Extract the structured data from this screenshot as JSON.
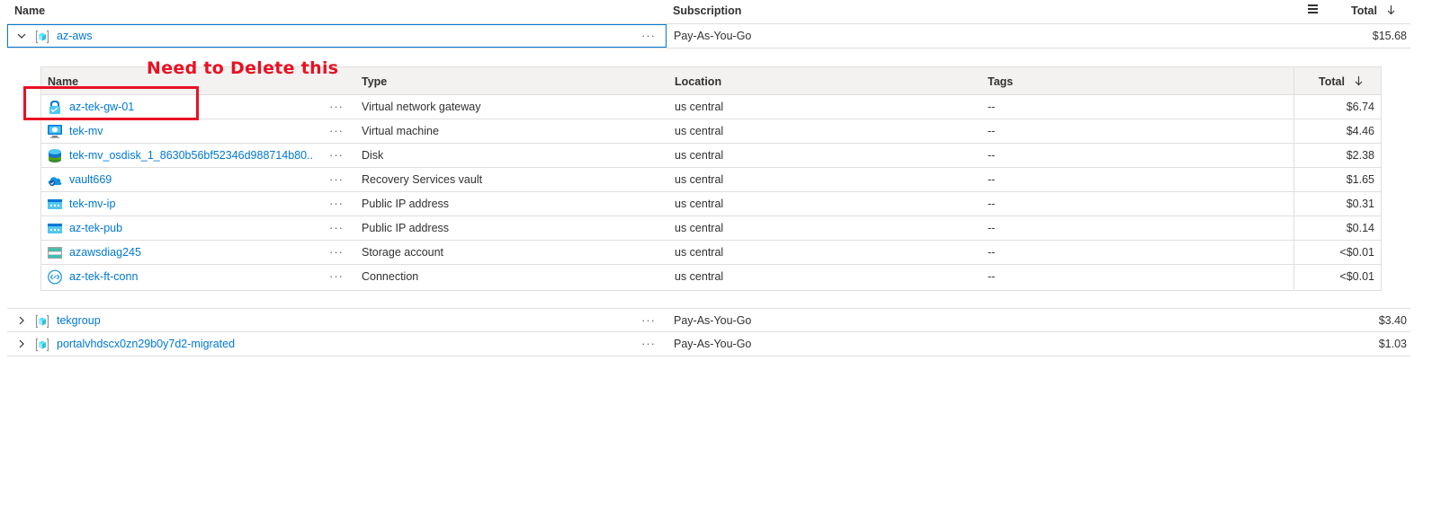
{
  "header": {
    "name_label": "Name",
    "subscription_label": "Subscription",
    "total_label": "Total",
    "sort_icon": "arrow-down-icon",
    "columns_icon": "hamburger-icon"
  },
  "resource_groups": [
    {
      "name": "az-aws",
      "subscription": "Pay-As-You-Go",
      "total": "$15.68",
      "expanded": true,
      "ellipsis": "···"
    },
    {
      "name": "tekgroup",
      "subscription": "Pay-As-You-Go",
      "total": "$3.40",
      "expanded": false,
      "ellipsis": "···"
    },
    {
      "name": "portalvhdscx0zn29b0y7d2-migrated",
      "subscription": "Pay-As-You-Go",
      "total": "$1.03",
      "expanded": false,
      "ellipsis": "···"
    }
  ],
  "inner_table": {
    "headers": {
      "name": "Name",
      "type": "Type",
      "location": "Location",
      "tags": "Tags",
      "total": "Total"
    },
    "rows": [
      {
        "name": "az-tek-gw-01",
        "type": "Virtual network gateway",
        "location": "us central",
        "tags": "--",
        "total": "$6.74",
        "icon": "vpn-gateway-icon",
        "ellipsis": "···"
      },
      {
        "name": "tek-mv",
        "type": "Virtual machine",
        "location": "us central",
        "tags": "--",
        "total": "$4.46",
        "icon": "virtual-machine-icon",
        "ellipsis": "···"
      },
      {
        "name": "tek-mv_osdisk_1_8630b56bf52346d988714b80...",
        "type": "Disk",
        "location": "us central",
        "tags": "--",
        "total": "$2.38",
        "icon": "disk-icon",
        "ellipsis": "···"
      },
      {
        "name": "vault669",
        "type": "Recovery Services vault",
        "location": "us central",
        "tags": "--",
        "total": "$1.65",
        "icon": "recovery-vault-icon",
        "ellipsis": "···"
      },
      {
        "name": "tek-mv-ip",
        "type": "Public IP address",
        "location": "us central",
        "tags": "--",
        "total": "$0.31",
        "icon": "public-ip-icon",
        "ellipsis": "···"
      },
      {
        "name": "az-tek-pub",
        "type": "Public IP address",
        "location": "us central",
        "tags": "--",
        "total": "$0.14",
        "icon": "public-ip-icon",
        "ellipsis": "···"
      },
      {
        "name": "azawsdiag245",
        "type": "Storage account",
        "location": "us central",
        "tags": "--",
        "total": "<$0.01",
        "icon": "storage-account-icon",
        "ellipsis": "···"
      },
      {
        "name": "az-tek-ft-conn",
        "type": "Connection",
        "location": "us central",
        "tags": "--",
        "total": "<$0.01",
        "icon": "connection-icon",
        "ellipsis": "···"
      }
    ]
  },
  "annotation": {
    "text": "Need to Delete this",
    "color": "#e81123"
  },
  "colors": {
    "link": "#0078d4",
    "border": "#e1dfdd",
    "header_bg": "#f3f2f1"
  }
}
